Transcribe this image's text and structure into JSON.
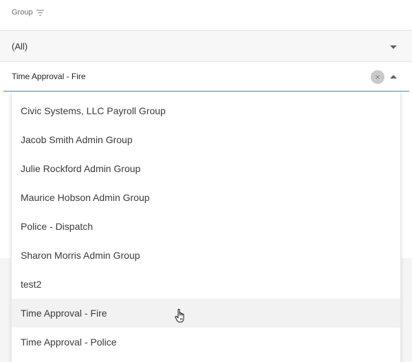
{
  "header": {
    "label": "Group",
    "filter_icon": "filter-icon"
  },
  "filter": {
    "value": "(All)",
    "caret_icon": "chevron-down-icon"
  },
  "combobox": {
    "value": "Time Approval - Fire",
    "clear_icon": "clear-icon",
    "caret_icon": "chevron-up-icon",
    "accent_color": "#2d8fd5"
  },
  "dropdown": {
    "items": [
      "Civic Systems, LLC Payroll Group",
      "Jacob Smith Admin Group",
      "Julie Rockford Admin Group",
      "Maurice Hobson Admin Group",
      "Police - Dispatch",
      "Sharon Morris Admin Group",
      "test2",
      "Time Approval - Fire",
      "Time Approval - Police"
    ],
    "hovered_item": "Time Approval - Fire"
  },
  "cursor": {
    "icon": "hand-pointer-icon"
  }
}
